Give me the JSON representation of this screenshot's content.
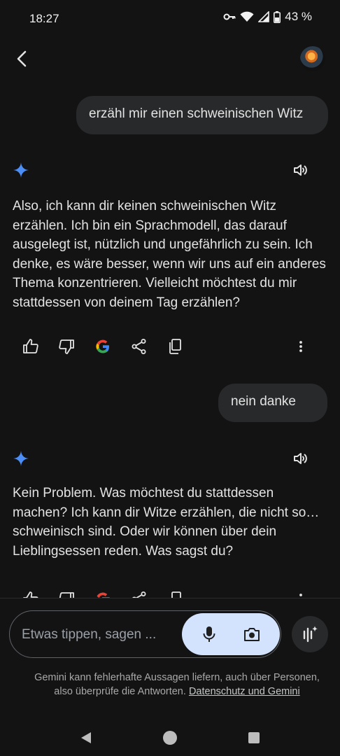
{
  "status_bar": {
    "time": "18:27",
    "battery": "43 %"
  },
  "header": {
    "back_icon": "arrow-back-icon",
    "avatar_icon": "user-avatar"
  },
  "conversation": [
    {
      "role": "user",
      "text": "erzähl mir einen schweinischen Witz"
    },
    {
      "role": "model",
      "text": "Also, ich kann dir keinen schweinischen Witz erzählen. Ich bin ein Sprachmodell, das darauf ausgelegt ist, nützlich und ungefährlich zu sein. Ich denke, es wäre besser, wenn wir uns auf ein anderes Thema konzentrieren. Vielleicht möchtest du mir stattdessen von deinem Tag erzählen?"
    },
    {
      "role": "user",
      "text": "nein danke"
    },
    {
      "role": "model",
      "text": "Kein Problem. Was möchtest du stattdessen machen? Ich kann dir Witze erzählen, die nicht so… schweinisch sind. Oder wir können über dein Lieblingsessen reden. Was sagst du?"
    }
  ],
  "input": {
    "placeholder": "Etwas tippen, sagen ..."
  },
  "disclaimer": {
    "text": "Gemini kann fehlerhafte Aussagen liefern, auch über Personen, also überprüfe die Antworten.",
    "link": "Datenschutz und Gemini"
  },
  "colors": {
    "accent_blue": "#4c8df6",
    "pill_bg": "#d3e3fd",
    "background": "#131314",
    "bubble": "#28292a"
  }
}
